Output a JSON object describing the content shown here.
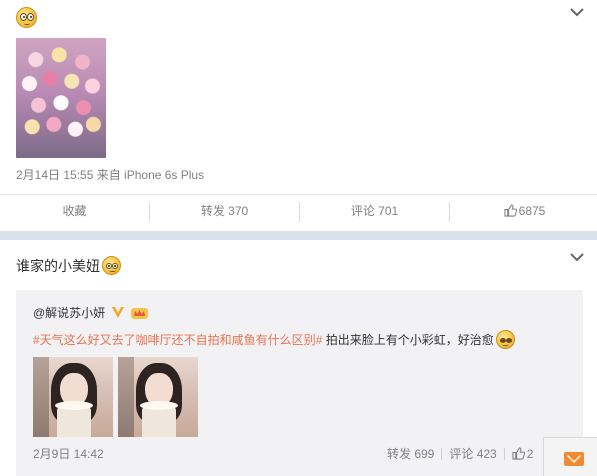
{
  "post1": {
    "emoji_icon": "sweat-smile-emoji-icon",
    "meta": "2月14日 15:55 来自 iPhone 6s Plus",
    "actions": {
      "favorite": "收藏",
      "repost": "转发 370",
      "comment": "评论 701",
      "like": "6875"
    }
  },
  "post2": {
    "text": "谁家的小美妞",
    "emoji_icon": "smirk-emoji-icon",
    "repost": {
      "author": "@解说苏小妍",
      "topic": "#天气这么好又去了咖啡厅还不自拍和咸鱼有什么区别#",
      "text": "拍出来脸上有个小彩虹，好治愈",
      "meta": "2月9日 14:42",
      "repost_count": "转发 699",
      "comment_count": "评论 423",
      "like_count": "2"
    }
  },
  "colors": {
    "topic": "#eb7350",
    "muted": "#808080",
    "mail": "#f28a33"
  }
}
